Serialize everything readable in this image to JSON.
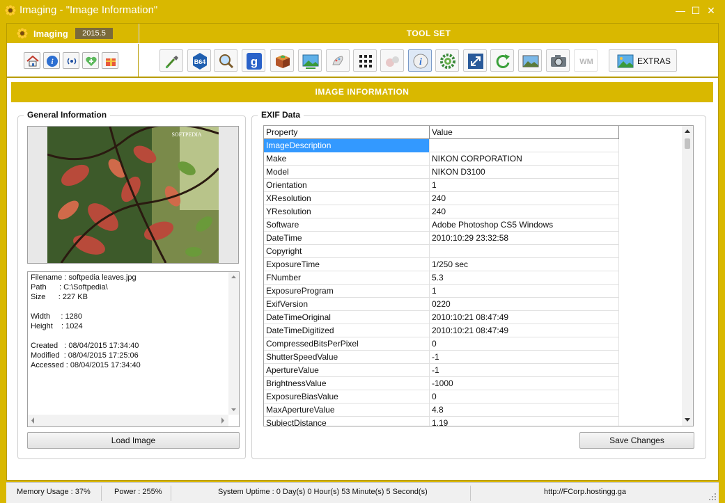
{
  "window": {
    "title": "Imaging - \"Image Information\"",
    "minimize": "—",
    "maximize": "☐",
    "close": "✕"
  },
  "brand": {
    "name": "Imaging",
    "version": "2015.5"
  },
  "toolset": {
    "label": "TOOL SET",
    "side_buttons": [
      "home-icon",
      "info-icon",
      "broadcast-icon",
      "heart-plus-icon",
      "gift-icon"
    ],
    "tools": [
      {
        "icon": "eyedropper-icon"
      },
      {
        "icon": "base64-icon",
        "text": "B64"
      },
      {
        "icon": "magnifier-icon"
      },
      {
        "icon": "google-icon",
        "text": "g"
      },
      {
        "icon": "box-icon"
      },
      {
        "icon": "image-swap-icon"
      },
      {
        "icon": "paint-icon"
      },
      {
        "icon": "grid-icon"
      },
      {
        "icon": "shapes-icon"
      },
      {
        "icon": "image-info-icon"
      },
      {
        "icon": "gear-icon"
      },
      {
        "icon": "resize-icon"
      },
      {
        "icon": "rotate-icon"
      },
      {
        "icon": "landscape-icon"
      },
      {
        "icon": "camera-icon"
      },
      {
        "icon": "watermark-icon",
        "text": "WM"
      }
    ],
    "extras_label": "EXTRAS"
  },
  "section_title": "IMAGE INFORMATION",
  "general": {
    "label": "General Information",
    "watermark": "SOFTPEDIA",
    "info_lines": [
      "Filename : softpedia leaves.jpg",
      "Path      : C:\\Softpedia\\",
      "Size      : 227 KB",
      "",
      "Width     : 1280",
      "Height    : 1024",
      "",
      "Created   : 08/04/2015 17:34:40",
      "Modified  : 08/04/2015 17:25:06",
      "Accessed : 08/04/2015 17:34:40"
    ],
    "load_button": "Load Image"
  },
  "exif": {
    "label": "EXIF Data",
    "columns": [
      "Property",
      "Value"
    ],
    "rows": [
      [
        "ImageDescription",
        ""
      ],
      [
        "Make",
        "NIKON CORPORATION"
      ],
      [
        "Model",
        "NIKON D3100"
      ],
      [
        "Orientation",
        "1"
      ],
      [
        "XResolution",
        "240"
      ],
      [
        "YResolution",
        "240"
      ],
      [
        "Software",
        "Adobe Photoshop CS5 Windows"
      ],
      [
        "DateTime",
        "2010:10:29 23:32:58"
      ],
      [
        "Copyright",
        ""
      ],
      [
        "ExposureTime",
        "1/250 sec"
      ],
      [
        "FNumber",
        "5.3"
      ],
      [
        "ExposureProgram",
        "1"
      ],
      [
        "ExifVersion",
        "0220"
      ],
      [
        "DateTimeOriginal",
        "2010:10:21 08:47:49"
      ],
      [
        "DateTimeDigitized",
        "2010:10:21 08:47:49"
      ],
      [
        "CompressedBitsPerPixel",
        "0"
      ],
      [
        "ShutterSpeedValue",
        "-1"
      ],
      [
        "ApertureValue",
        "-1"
      ],
      [
        "BrightnessValue",
        "-1000"
      ],
      [
        "ExposureBiasValue",
        "0"
      ],
      [
        "MaxApertureValue",
        "4.8"
      ],
      [
        "SubjectDistance",
        "1.19"
      ]
    ],
    "save_button": "Save Changes"
  },
  "status": {
    "memory": "Memory Usage : 37%",
    "power": "Power : 255%",
    "uptime": "System Uptime : 0 Day(s) 0 Hour(s) 53 Minute(s) 5 Second(s)",
    "url": "http://FCorp.hostingg.ga"
  },
  "colors": {
    "accent": "#d9b800",
    "selection": "#3399ff"
  }
}
